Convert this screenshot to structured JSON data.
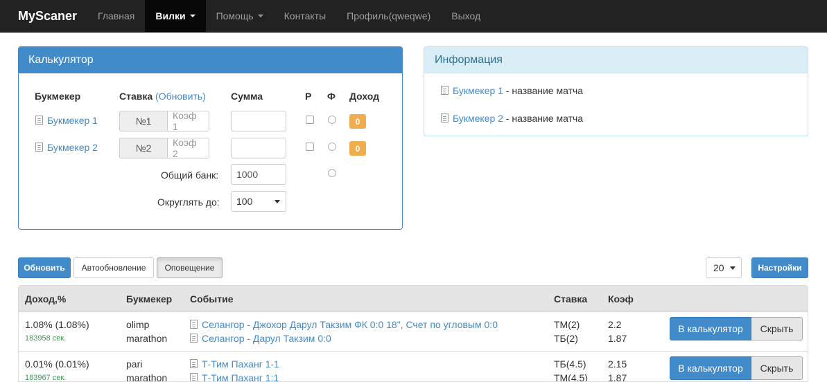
{
  "navbar": {
    "brand": "MyScaner",
    "items": [
      {
        "label": "Главная"
      },
      {
        "label": "Вилки"
      },
      {
        "label": "Помощь"
      },
      {
        "label": "Контакты"
      },
      {
        "label": "Профиль(qweqwe)"
      },
      {
        "label": "Выход"
      }
    ]
  },
  "calculator": {
    "title": "Калькулятор",
    "headers": {
      "bookmaker": "Букмекер",
      "stake": "Ставка",
      "refresh": "(Обновить)",
      "sum": "Сумма",
      "r": "Р",
      "f": "Ф",
      "income": "Доход"
    },
    "rows": [
      {
        "bookmaker": "Букмекер 1",
        "num": "№1",
        "coef_placeholder": "Коэф 1",
        "sum": "",
        "income": "0"
      },
      {
        "bookmaker": "Букмекер 2",
        "num": "№2",
        "coef_placeholder": "Коэф 2",
        "sum": "",
        "income": "0"
      }
    ],
    "total_bank_label": "Общий банк:",
    "total_bank_value": "1000",
    "round_label": "Округлять до:",
    "round_value": "100"
  },
  "info": {
    "title": "Информация",
    "items": [
      {
        "bookmaker": "Букмекер 1",
        "text": " - название матча"
      },
      {
        "bookmaker": "Букмекер 2",
        "text": " - название матча"
      }
    ]
  },
  "toolbar": {
    "refresh": "Обновить",
    "autorefresh": "Автообновление",
    "notify": "Оповещение",
    "page_size": "20",
    "settings": "Настройки"
  },
  "table": {
    "headers": {
      "income": "Доход,%",
      "bookmaker": "Букмекер",
      "event": "Событие",
      "stake": "Ставка",
      "coef": "Коэф"
    },
    "rows": [
      {
        "income": "1.08% (1.08%)",
        "seconds": "183958 сек.",
        "bookmakers": [
          "olimp",
          "marathon"
        ],
        "events": [
          "Селангор - Джохор Дарул Такзим ФК 0:0 18\", Счет по угловым 0:0",
          "Селангор - Дарул Такзим 0:0"
        ],
        "stakes": [
          "ТМ(2)",
          "ТБ(2)"
        ],
        "coefs": [
          "2.2",
          "1.87"
        ],
        "calc_button": "В калькулятор",
        "hide_button": "Скрыть"
      },
      {
        "income": "0.01% (0.01%)",
        "seconds": "183967 сек.",
        "bookmakers": [
          "pari",
          "marathon"
        ],
        "events": [
          "Т-Тим Паханг 1-1",
          "Т-Тим Паханг 1:1"
        ],
        "stakes": [
          "ТБ(4.5)",
          "ТМ(4.5)"
        ],
        "coefs": [
          "2.15",
          "1.87"
        ],
        "calc_button": "В калькулятор",
        "hide_button": "Скрыть"
      }
    ]
  }
}
